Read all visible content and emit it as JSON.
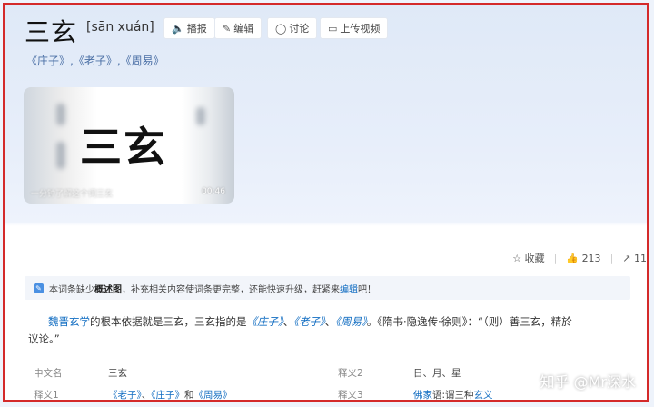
{
  "header": {
    "title": "三玄",
    "pinyin": "[sān xuán]",
    "buttons": [
      {
        "icon": "speaker-icon",
        "label": "播报"
      },
      {
        "icon": "edit-icon",
        "label": "编辑"
      },
      {
        "icon": "comment-icon",
        "label": "讨论"
      },
      {
        "icon": "video-icon",
        "label": "上传视频"
      }
    ],
    "subtitle": "《庄子》,《老子》,《周易》"
  },
  "video": {
    "title": "三玄",
    "caption": "一分钟了解这个词三玄",
    "duration": "00:46"
  },
  "actions": {
    "collect_label": "收藏",
    "like_count": "213",
    "share_count": "11"
  },
  "notice": {
    "prefix": "本词条缺少",
    "bold": "概述图",
    "middle": "，补充相关内容使词条更完整，还能快速升级，赶紧来",
    "link": "编辑",
    "suffix": "吧！"
  },
  "paragraph": {
    "link1": "魏晋玄学",
    "text1": "的根本依据就是三玄，三玄指的是",
    "book1": "《庄子》",
    "sep1": "、",
    "book2": "《老子》",
    "sep2": "、",
    "book3": "《周易》",
    "text2": "。《隋书·隐逸传·徐则》：“（则）善三玄，精於",
    "text3": "议论。”"
  },
  "info": {
    "row1": {
      "label1": "中文名",
      "value1": "三玄",
      "label2": "释义2",
      "value2": "日、月、星"
    },
    "row2": {
      "label1": "释义1",
      "book1": "《老子》",
      "sep1": "、",
      "book2": "《庄子》",
      "and": "和",
      "book3": "《周易》",
      "label2": "释义3",
      "link": "佛家",
      "value_mid": "语:谓三种",
      "link2": "玄义"
    }
  },
  "watermark": "知乎 @Mr深水"
}
